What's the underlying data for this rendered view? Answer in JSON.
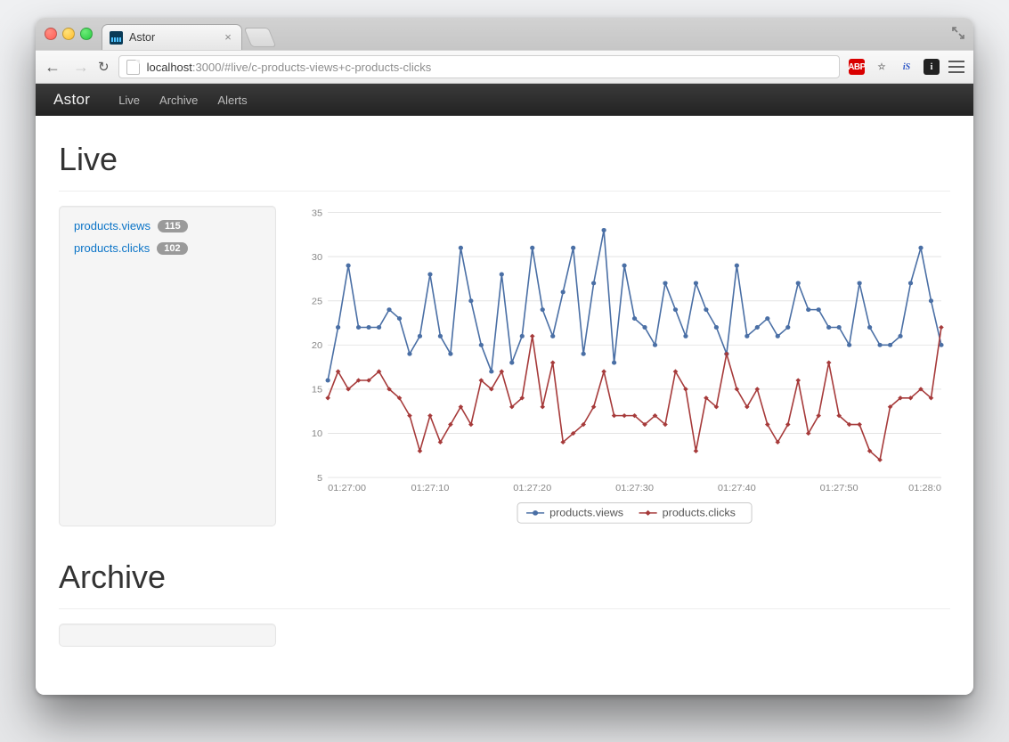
{
  "browser": {
    "tab_title": "Astor",
    "url_host": "localhost",
    "url_port_path": ":3000/#live/c-products-views+c-products-clicks"
  },
  "app_nav": {
    "brand": "Astor",
    "items": [
      "Live",
      "Archive",
      "Alerts"
    ]
  },
  "sections": {
    "live_heading": "Live",
    "archive_heading": "Archive"
  },
  "metrics": [
    {
      "name": "products.views",
      "badge": "115"
    },
    {
      "name": "products.clicks",
      "badge": "102"
    }
  ],
  "legend": {
    "views": "products.views",
    "clicks": "products.clicks"
  },
  "chart_data": {
    "type": "line",
    "title": "",
    "xlabel": "",
    "ylabel": "",
    "ylim": [
      5,
      35
    ],
    "y_ticks": [
      5,
      10,
      15,
      20,
      25,
      30,
      35
    ],
    "x_tick_labels": [
      "01:27:00",
      "01:27:10",
      "01:27:20",
      "01:27:30",
      "01:27:40",
      "01:27:50",
      "01:28:0"
    ],
    "x_tick_positions": [
      0,
      10,
      20,
      30,
      40,
      50,
      60
    ],
    "x": [
      0,
      1,
      2,
      3,
      4,
      5,
      6,
      7,
      8,
      9,
      10,
      11,
      12,
      13,
      14,
      15,
      16,
      17,
      18,
      19,
      20,
      21,
      22,
      23,
      24,
      25,
      26,
      27,
      28,
      29,
      30,
      31,
      32,
      33,
      34,
      35,
      36,
      37,
      38,
      39,
      40,
      41,
      42,
      43,
      44,
      45,
      46,
      47,
      48,
      49,
      50,
      51,
      52,
      53,
      54,
      55,
      56,
      57,
      58,
      59,
      60
    ],
    "series": [
      {
        "name": "products.views",
        "color": "#4a6fa5",
        "values": [
          16,
          22,
          29,
          22,
          22,
          22,
          24,
          23,
          19,
          21,
          28,
          21,
          19,
          31,
          25,
          20,
          17,
          28,
          18,
          21,
          31,
          24,
          21,
          26,
          31,
          19,
          27,
          33,
          18,
          29,
          23,
          22,
          20,
          27,
          24,
          21,
          27,
          24,
          22,
          19,
          29,
          21,
          22,
          23,
          21,
          22,
          27,
          24,
          24,
          22,
          22,
          20,
          27,
          22,
          20,
          20,
          21,
          27,
          31,
          25,
          20
        ]
      },
      {
        "name": "products.clicks",
        "color": "#a63a3a",
        "values": [
          14,
          17,
          15,
          16,
          16,
          17,
          15,
          14,
          12,
          8,
          12,
          9,
          11,
          13,
          11,
          16,
          15,
          17,
          13,
          14,
          21,
          13,
          18,
          9,
          10,
          11,
          13,
          17,
          12,
          12,
          12,
          11,
          12,
          11,
          17,
          15,
          8,
          14,
          13,
          19,
          15,
          13,
          15,
          11,
          9,
          11,
          16,
          10,
          12,
          18,
          12,
          11,
          11,
          8,
          7,
          13,
          14,
          14,
          15,
          14,
          22
        ]
      }
    ]
  }
}
